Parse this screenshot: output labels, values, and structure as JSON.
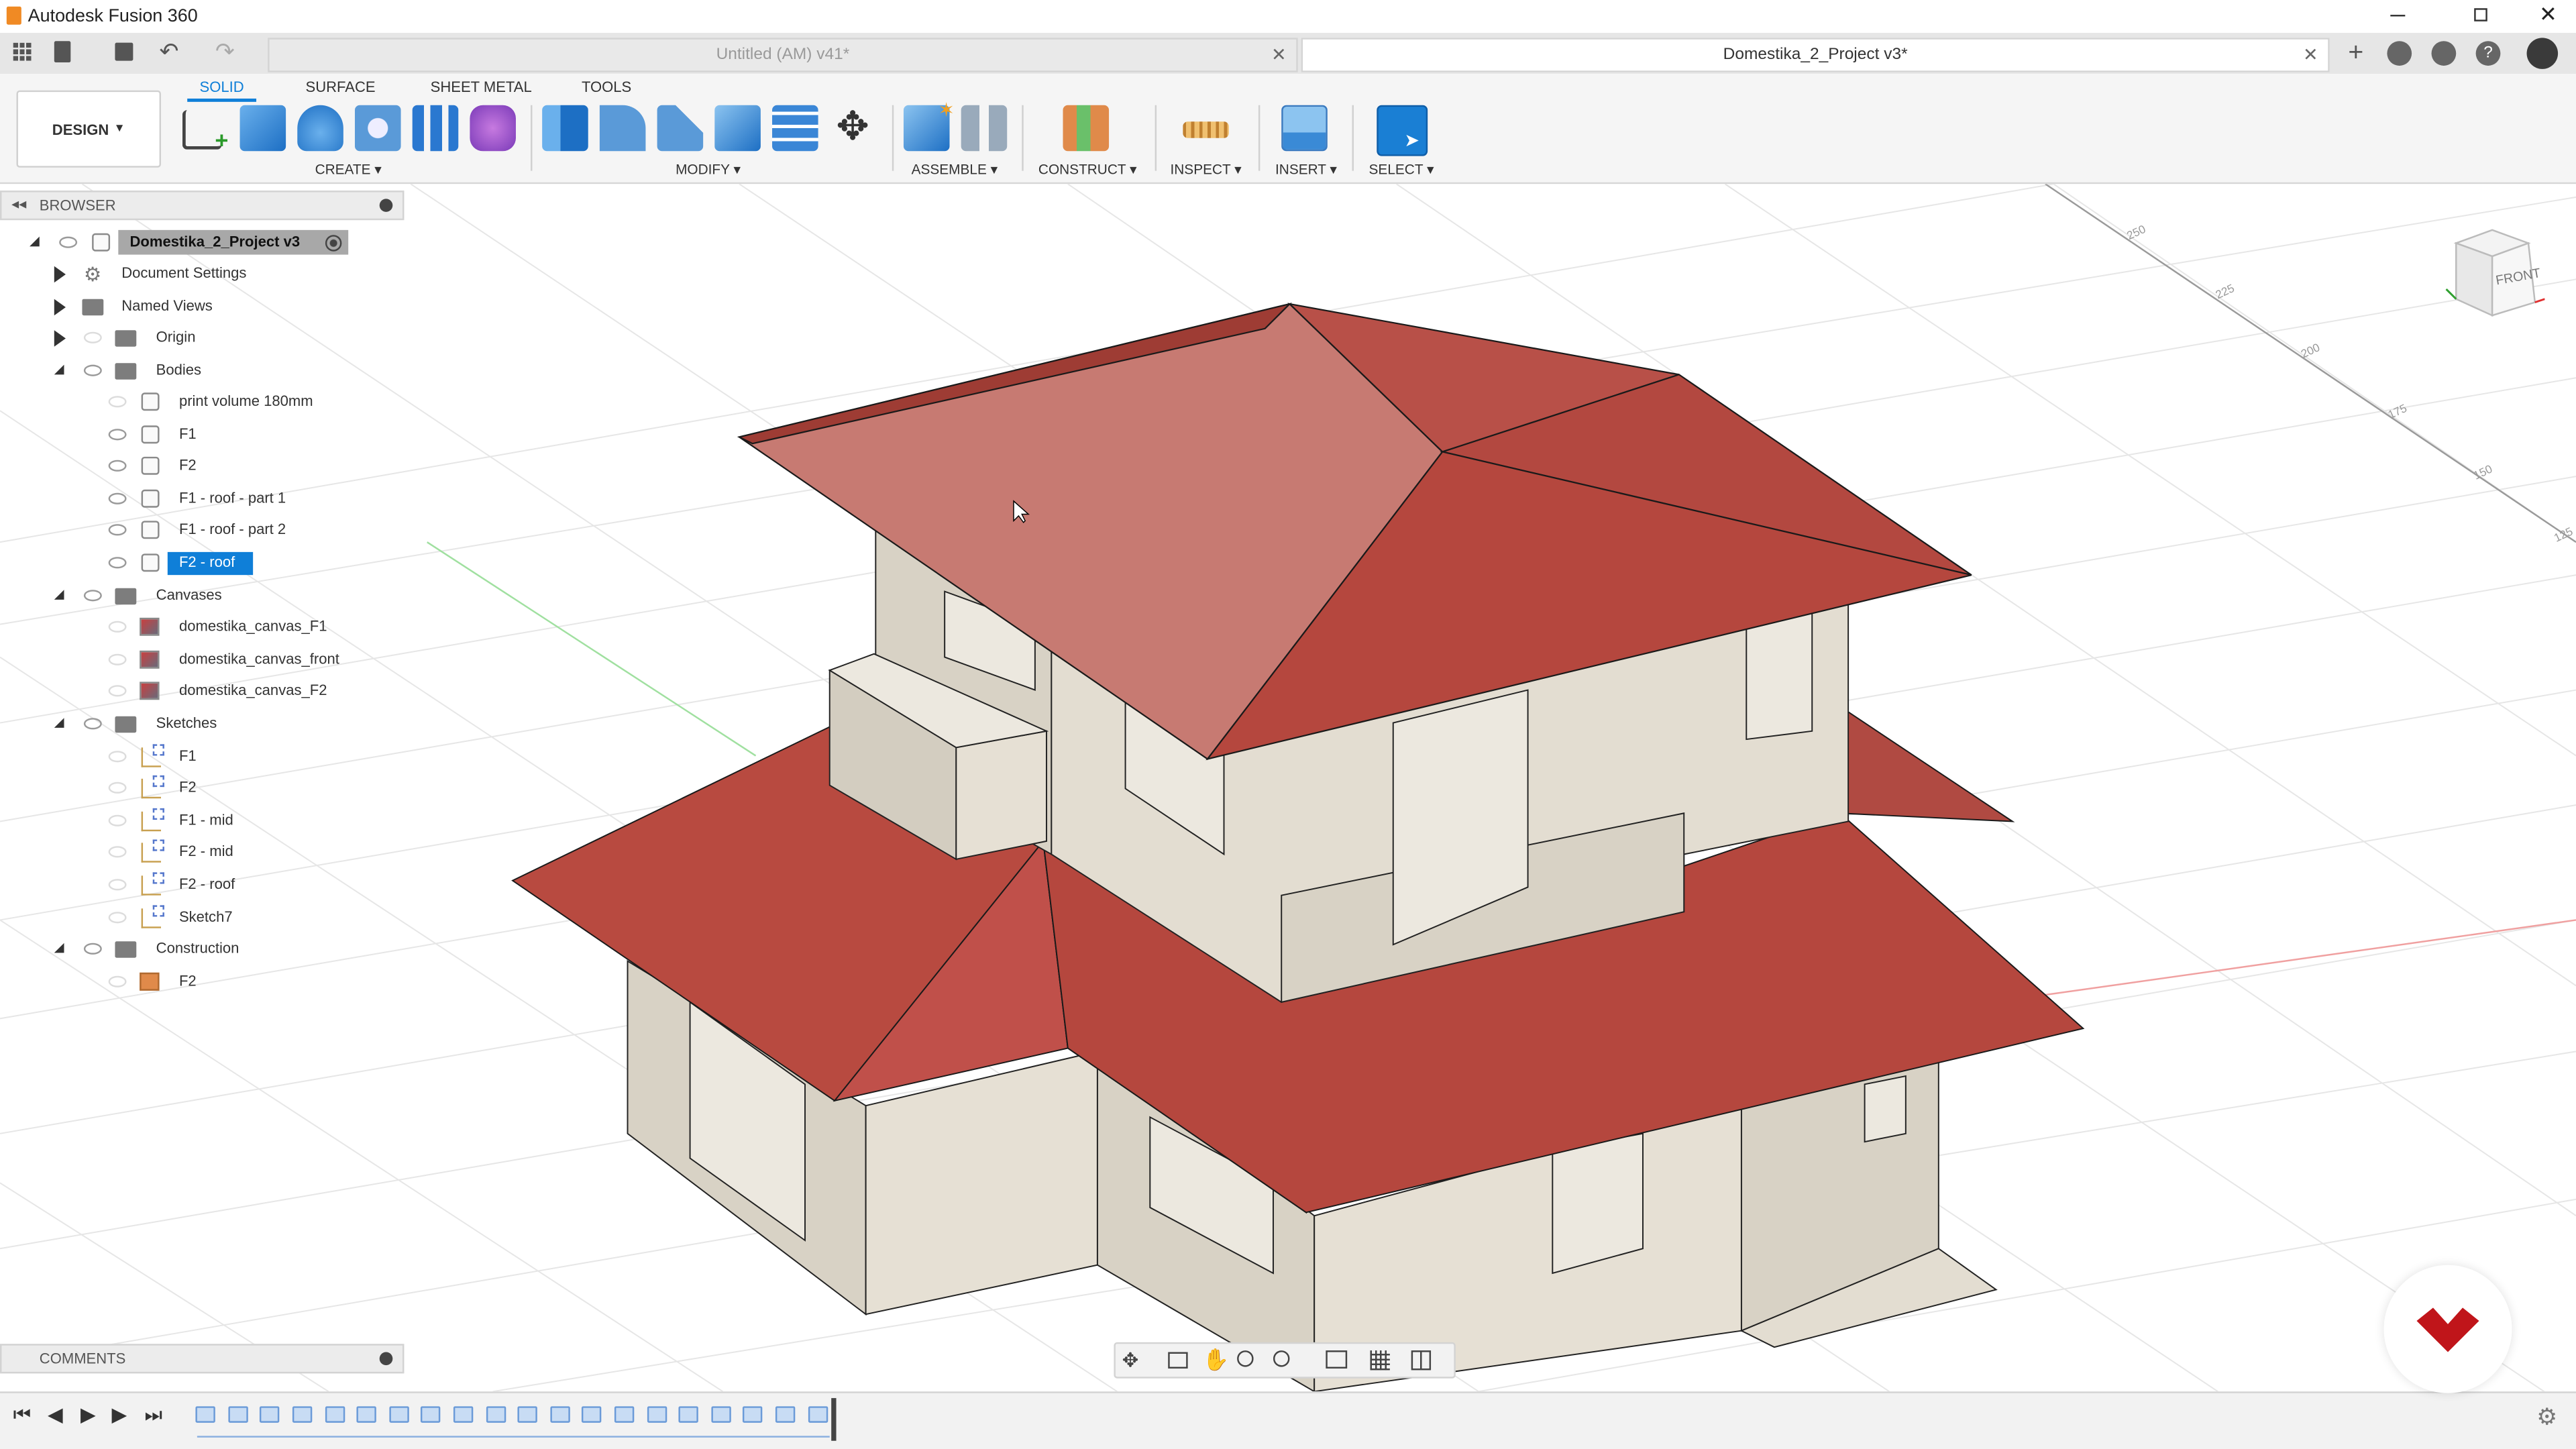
{
  "app": {
    "title": "Autodesk Fusion 360"
  },
  "tabs": [
    {
      "label": "Untitled (AM) v41*"
    },
    {
      "label": "Domestika_2_Project v3*"
    }
  ],
  "ribbon": {
    "workspace": "DESIGN",
    "tabs": [
      "SOLID",
      "SURFACE",
      "SHEET METAL",
      "TOOLS"
    ],
    "groups": [
      "CREATE",
      "MODIFY",
      "ASSEMBLE",
      "CONSTRUCT",
      "INSPECT",
      "INSERT",
      "SELECT"
    ]
  },
  "browser": {
    "title": "BROWSER",
    "root": "Domestika_2_Project v3",
    "items": [
      {
        "label": "Document Settings"
      },
      {
        "label": "Named Views"
      },
      {
        "label": "Origin"
      },
      {
        "label": "Bodies"
      },
      {
        "label": "print volume 180mm"
      },
      {
        "label": "F1"
      },
      {
        "label": "F2"
      },
      {
        "label": "F1 - roof - part 1"
      },
      {
        "label": "F1 - roof - part 2"
      },
      {
        "label": "F2 - roof"
      },
      {
        "label": "Canvases"
      },
      {
        "label": "domestika_canvas_F1"
      },
      {
        "label": "domestika_canvas_front"
      },
      {
        "label": "domestika_canvas_F2"
      },
      {
        "label": "Sketches"
      },
      {
        "label": "F1"
      },
      {
        "label": "F2"
      },
      {
        "label": "F1 - mid"
      },
      {
        "label": "F2 - mid"
      },
      {
        "label": "F2 - roof"
      },
      {
        "label": "Sketch7"
      },
      {
        "label": "Construction"
      },
      {
        "label": "F2"
      }
    ]
  },
  "comments": {
    "title": "COMMENTS"
  },
  "viewcube": {
    "face": "FRONT"
  },
  "grid_labels": [
    "250",
    "225",
    "200",
    "175",
    "150",
    "125"
  ],
  "colors": {
    "roof": "#b5473e",
    "roof_light": "#c77a72",
    "walls": "#e3ddd1",
    "selection": "#0f7fd8",
    "logo": "#c0151a"
  }
}
